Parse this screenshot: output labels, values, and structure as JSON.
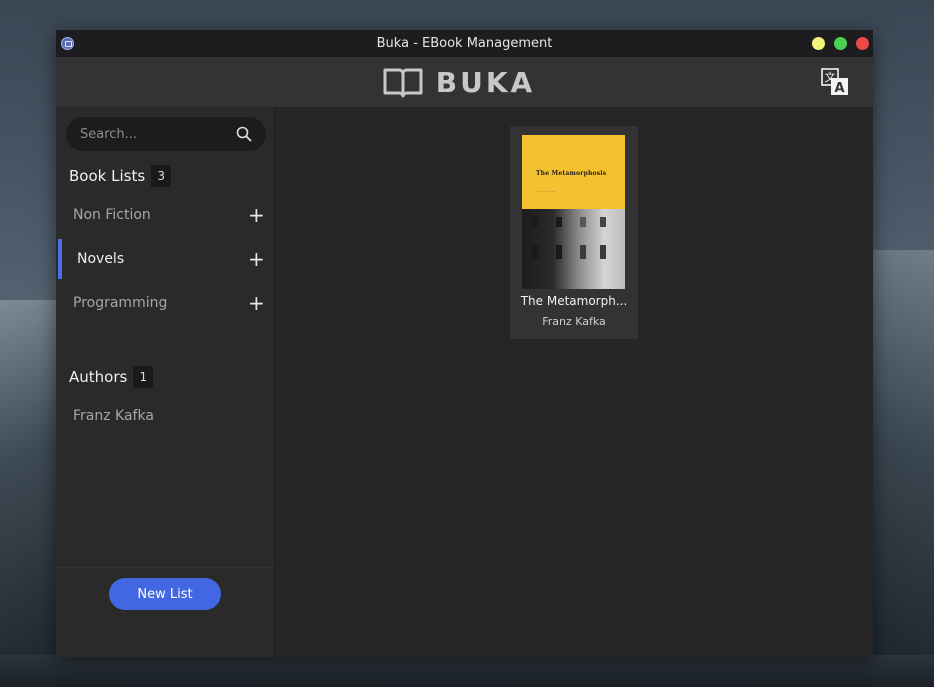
{
  "window": {
    "title": "Buka - EBook Management"
  },
  "header": {
    "logo_text": "BUKA",
    "translate_icon": "translate-icon"
  },
  "search": {
    "placeholder": "Search..."
  },
  "book_lists": {
    "heading": "Book Lists",
    "count": "3",
    "items": [
      {
        "label": "Non Fiction",
        "active": false
      },
      {
        "label": "Novels",
        "active": true
      },
      {
        "label": "Programming",
        "active": false
      }
    ]
  },
  "authors": {
    "heading": "Authors",
    "count": "1",
    "items": [
      {
        "label": "Franz Kafka"
      }
    ]
  },
  "footer": {
    "new_list_label": "New List"
  },
  "books": [
    {
      "title": "The Metamorph...",
      "author": "Franz Kafka",
      "cover_title": "The Metamorphosis",
      "cover_color": "#f4c130"
    }
  ],
  "colors": {
    "accent": "#4168e2",
    "active_indicator": "#4b6fe6",
    "win_minimize": "#f3f57a",
    "win_maximize": "#4bd151",
    "win_close": "#f04848"
  }
}
